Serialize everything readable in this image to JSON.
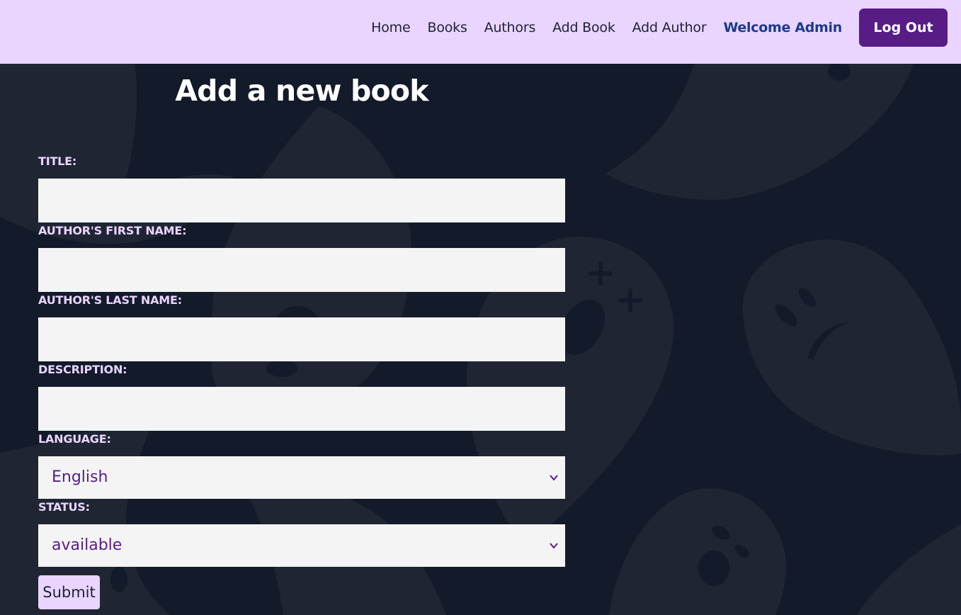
{
  "nav": {
    "links": [
      "Home",
      "Books",
      "Authors",
      "Add Book",
      "Add Author"
    ],
    "welcome": "Welcome Admin",
    "logout_label": "Log Out"
  },
  "page": {
    "title": "Add a new book"
  },
  "form": {
    "title_label": "TITLE:",
    "first_name_label": "AUTHOR'S FIRST NAME:",
    "last_name_label": "AUTHOR'S LAST NAME:",
    "description_label": "DESCRIPTION:",
    "language_label": "LANGUAGE:",
    "language_value": "English",
    "status_label": "STATUS:",
    "status_value": "available",
    "title_value": "",
    "first_name_value": "",
    "last_name_value": "",
    "description_value": "",
    "submit_label": "Submit"
  },
  "icons": {
    "dropdown": "chevron-down-icon",
    "background": "ghost-icon"
  },
  "colors": {
    "navbar_bg": "#e9d5ff",
    "page_bg": "#131a2a",
    "logout_bg": "#581c87",
    "welcome_text": "#1e3a8a",
    "label_text": "#e9d5ff",
    "select_text": "#581c87",
    "ghost": "#1f2533"
  }
}
